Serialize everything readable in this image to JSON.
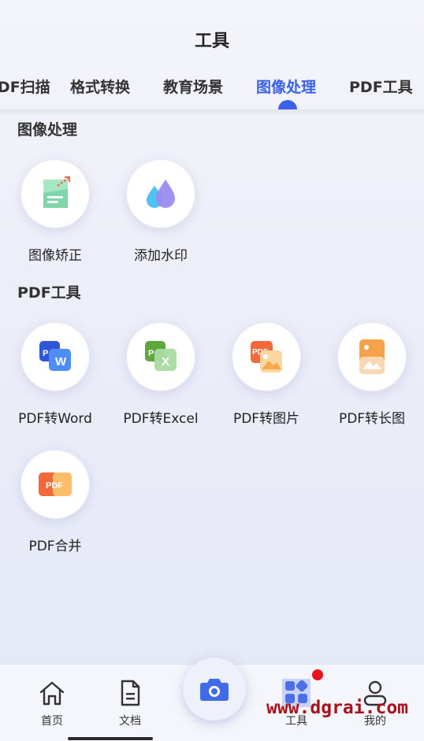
{
  "header": {
    "title": "工具"
  },
  "tabs": [
    {
      "label": "PDF扫描"
    },
    {
      "label": "格式转换"
    },
    {
      "label": "教育场景"
    },
    {
      "label": "图像处理"
    },
    {
      "label": "PDF工具"
    }
  ],
  "active_tab": "图像处理",
  "sections": {
    "image": {
      "title": "图像处理",
      "items": [
        {
          "label": "图像矫正",
          "icon": "image-correction-icon"
        },
        {
          "label": "添加水印",
          "icon": "watermark-drops-icon"
        }
      ]
    },
    "pdf": {
      "title": "PDF工具",
      "items": [
        {
          "label": "PDF转Word",
          "icon": "pdf-to-word-icon"
        },
        {
          "label": "PDF转Excel",
          "icon": "pdf-to-excel-icon"
        },
        {
          "label": "PDF转图片",
          "icon": "pdf-to-image-icon"
        },
        {
          "label": "PDF转长图",
          "icon": "pdf-to-long-image-icon"
        },
        {
          "label": "PDF合并",
          "icon": "pdf-merge-icon"
        }
      ]
    }
  },
  "bottom_nav": [
    {
      "label": "首页",
      "icon": "home-icon"
    },
    {
      "label": "文档",
      "icon": "document-icon"
    },
    {
      "label": "",
      "icon": "camera-icon"
    },
    {
      "label": "工具",
      "icon": "tools-grid-icon",
      "badge": true
    },
    {
      "label": "我的",
      "icon": "profile-icon"
    }
  ],
  "watermark_text": "www.dgrai.com",
  "colors": {
    "accent": "#3a62e8",
    "badge": "#e8131f",
    "watermark": "#a8121c"
  }
}
